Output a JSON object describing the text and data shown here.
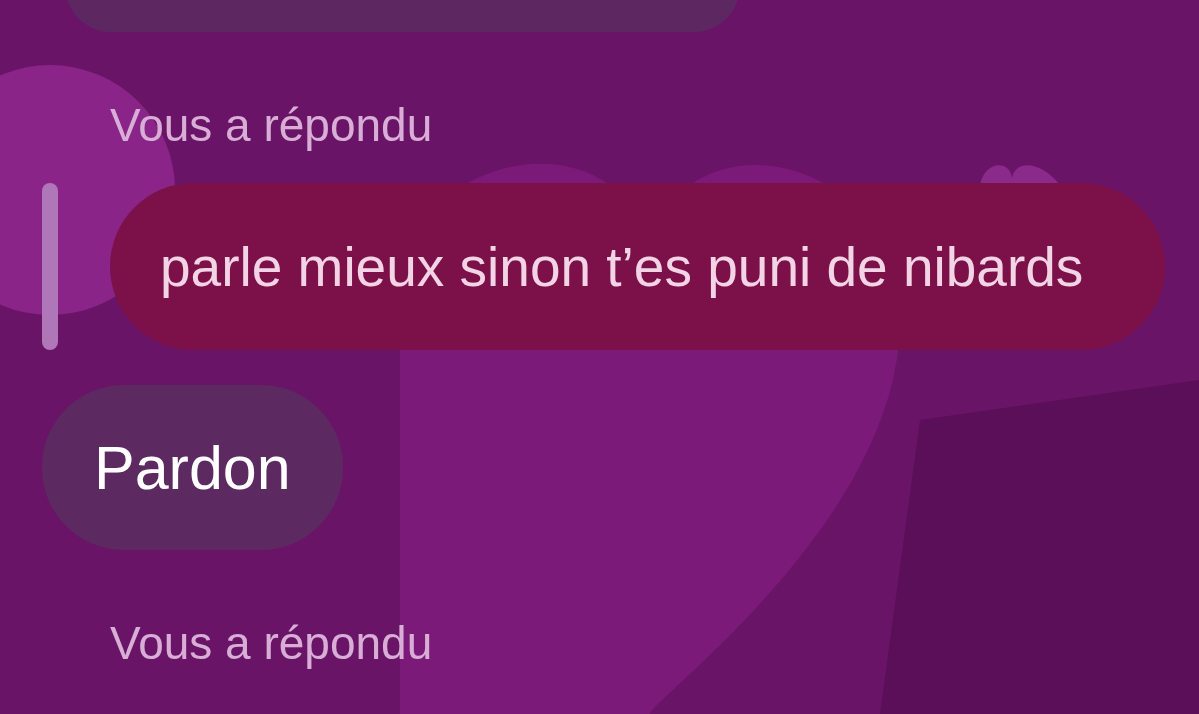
{
  "messages": [
    {
      "kind": "partial-bubble"
    },
    {
      "kind": "reply-label",
      "text": "Vous a répondu"
    },
    {
      "kind": "quoted-reply",
      "text": "parle mieux sinon t’es puni de nibards"
    },
    {
      "kind": "bubble",
      "text": "Pardon"
    },
    {
      "kind": "reply-label",
      "text": "Vous a répondu"
    }
  ]
}
